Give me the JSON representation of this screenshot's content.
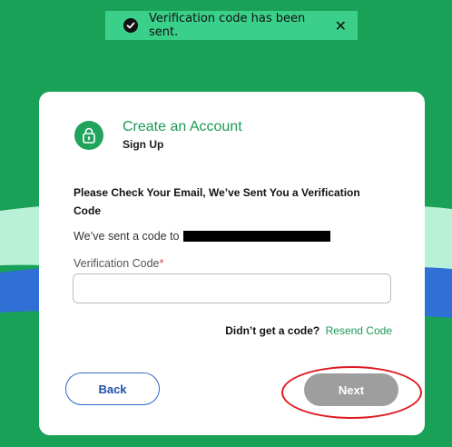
{
  "toast": {
    "message": "Verification code has been sent.",
    "check_icon": "check-circle-icon",
    "close_label": "✕"
  },
  "header": {
    "title": "Create an Account",
    "subtitle": "Sign Up",
    "icon": "lock-icon"
  },
  "content": {
    "heading": "Please Check Your Email, We’ve Sent You a Verification Code",
    "sent_prefix": "We’ve sent a code to"
  },
  "field": {
    "label": "Verification Code",
    "required_mark": "*",
    "value": "",
    "placeholder": ""
  },
  "resend": {
    "question": "Didn’t get a code?",
    "link": "Resend Code"
  },
  "buttons": {
    "back": "Back",
    "next": "Next"
  },
  "colors": {
    "background": "#1aa158",
    "accent": "#1c9a56",
    "toast": "#3ad08a",
    "back_border": "#2f66c8",
    "next_disabled": "#9e9e9e",
    "annotation": "#e0181f"
  }
}
